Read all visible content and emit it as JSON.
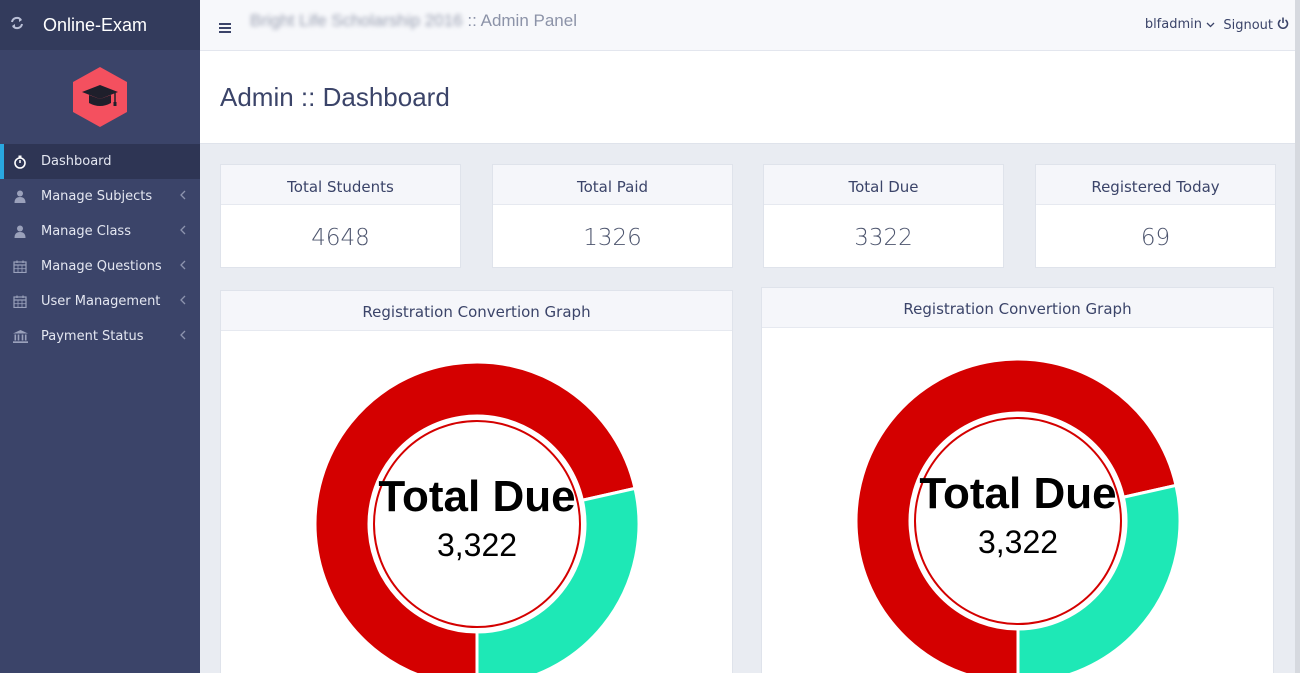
{
  "brand": {
    "name": "Online-Exam"
  },
  "sidebar": {
    "items": [
      {
        "label": "Dashboard",
        "icon": "stopwatch-icon",
        "active": true
      },
      {
        "label": "Manage Subjects",
        "icon": "user-icon"
      },
      {
        "label": "Manage Class",
        "icon": "user-icon"
      },
      {
        "label": "Manage Questions",
        "icon": "calendar-icon"
      },
      {
        "label": "User Management",
        "icon": "calendar-icon"
      },
      {
        "label": "Payment Status",
        "icon": "bank-icon"
      }
    ]
  },
  "topbar": {
    "blurred_title": "Bright Life Scholarship 2016",
    "title_suffix": ":: Admin Panel",
    "username": "blfadmin",
    "signout_label": "Signout"
  },
  "page": {
    "title": "Admin :: Dashboard"
  },
  "stats": [
    {
      "label": "Total Students",
      "value": "4648"
    },
    {
      "label": "Total Paid",
      "value": "1326"
    },
    {
      "label": "Total Due",
      "value": "3322"
    },
    {
      "label": "Registered Today",
      "value": "69"
    }
  ],
  "charts": [
    {
      "title": "Registration Convertion Graph",
      "center_label": "Total Due",
      "center_value": "3,322"
    },
    {
      "title": "Registration Convertion Graph",
      "center_label": "Total Due",
      "center_value": "3,322"
    }
  ],
  "chart_data": [
    {
      "type": "pie",
      "variant": "doughnut",
      "title": "Registration Convertion Graph",
      "center_text": "Total Due",
      "center_value": "3,322",
      "slices": [
        {
          "value": 3322,
          "color": "#d40000"
        },
        {
          "value": 1326,
          "color": "#1ee8b6"
        }
      ]
    },
    {
      "type": "pie",
      "variant": "doughnut",
      "title": "Registration Convertion Graph",
      "center_text": "Total Due",
      "center_value": "3,322",
      "slices": [
        {
          "value": 3322,
          "color": "#d40000"
        },
        {
          "value": 1326,
          "color": "#1ee8b6"
        }
      ]
    }
  ],
  "colors": {
    "sidebar_bg": "#3b4469",
    "accent": "#29a8e0",
    "logo": "#f4505f",
    "due": "#d40000",
    "paid": "#1ee8b6"
  }
}
